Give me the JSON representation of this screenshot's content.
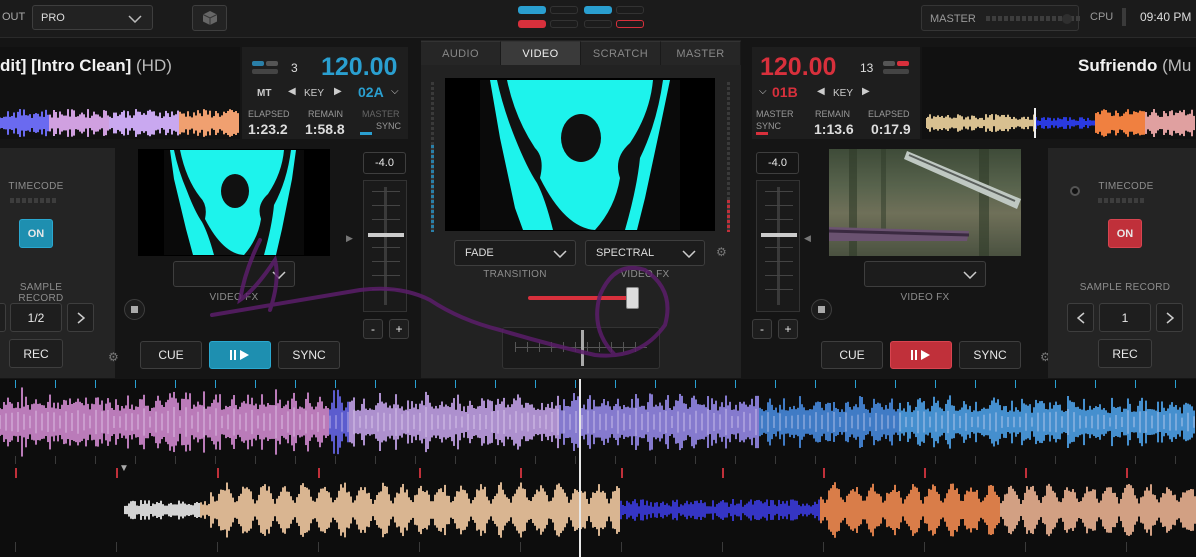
{
  "topbar": {
    "out_label": "OUT",
    "mode_value": "PRO",
    "master_label": "MASTER",
    "cpu_label": "CPU",
    "clock": "09:40 PM"
  },
  "deck_left": {
    "title_main": "dit] [Intro Clean]",
    "title_suffix": "(HD)",
    "bpm": "120.00",
    "deck_number": "3",
    "mt_label": "MT",
    "key_label": "KEY",
    "key_value": "02A",
    "elapsed_label": "ELAPSED",
    "elapsed": "1:23.2",
    "remain_label": "REMAIN",
    "remain": "1:58.8",
    "master_label": "MASTER",
    "sync_label": "SYNC",
    "timecode_label": "TIMECODE",
    "on_label": "ON",
    "sample_record_label": "SAMPLE RECORD",
    "sample_value": "1/2",
    "rec_label": "REC",
    "pitch_value": "-4.0",
    "video_fx_label": "VIDEO FX",
    "cue_label": "CUE",
    "sync_button": "SYNC",
    "minus": "-",
    "plus": "+",
    "on_color": "#1e8fb0"
  },
  "deck_right": {
    "title_main": "Sufriendo",
    "title_suffix": "(Mu",
    "bpm": "120.00",
    "deck_number": "13",
    "key_label": "KEY",
    "key_value": "01B",
    "master_label": "MASTER",
    "sync_label": "SYNC",
    "remain_label": "REMAIN",
    "remain": "1:13.6",
    "elapsed_label": "ELAPSED",
    "elapsed": "0:17.9",
    "timecode_label": "TIMECODE",
    "on_label": "ON",
    "sample_record_label": "SAMPLE RECORD",
    "sample_value": "1",
    "rec_label": "REC",
    "pitch_value": "-4.0",
    "video_fx_label": "VIDEO FX",
    "cue_label": "CUE",
    "sync_button": "SYNC",
    "minus": "-",
    "plus": "+",
    "on_color": "#c0303a"
  },
  "center": {
    "tabs": [
      "AUDIO",
      "VIDEO",
      "SCRATCH",
      "MASTER"
    ],
    "active_tab": "VIDEO",
    "transition_value": "FADE",
    "transition_label": "TRANSITION",
    "videofx_value": "SPECTRAL",
    "videofx_label": "VIDEO FX"
  },
  "colors": {
    "blue_accent": "#2a9fd0",
    "red_accent": "#d8303c",
    "video_cyan": "#1df3ec"
  }
}
